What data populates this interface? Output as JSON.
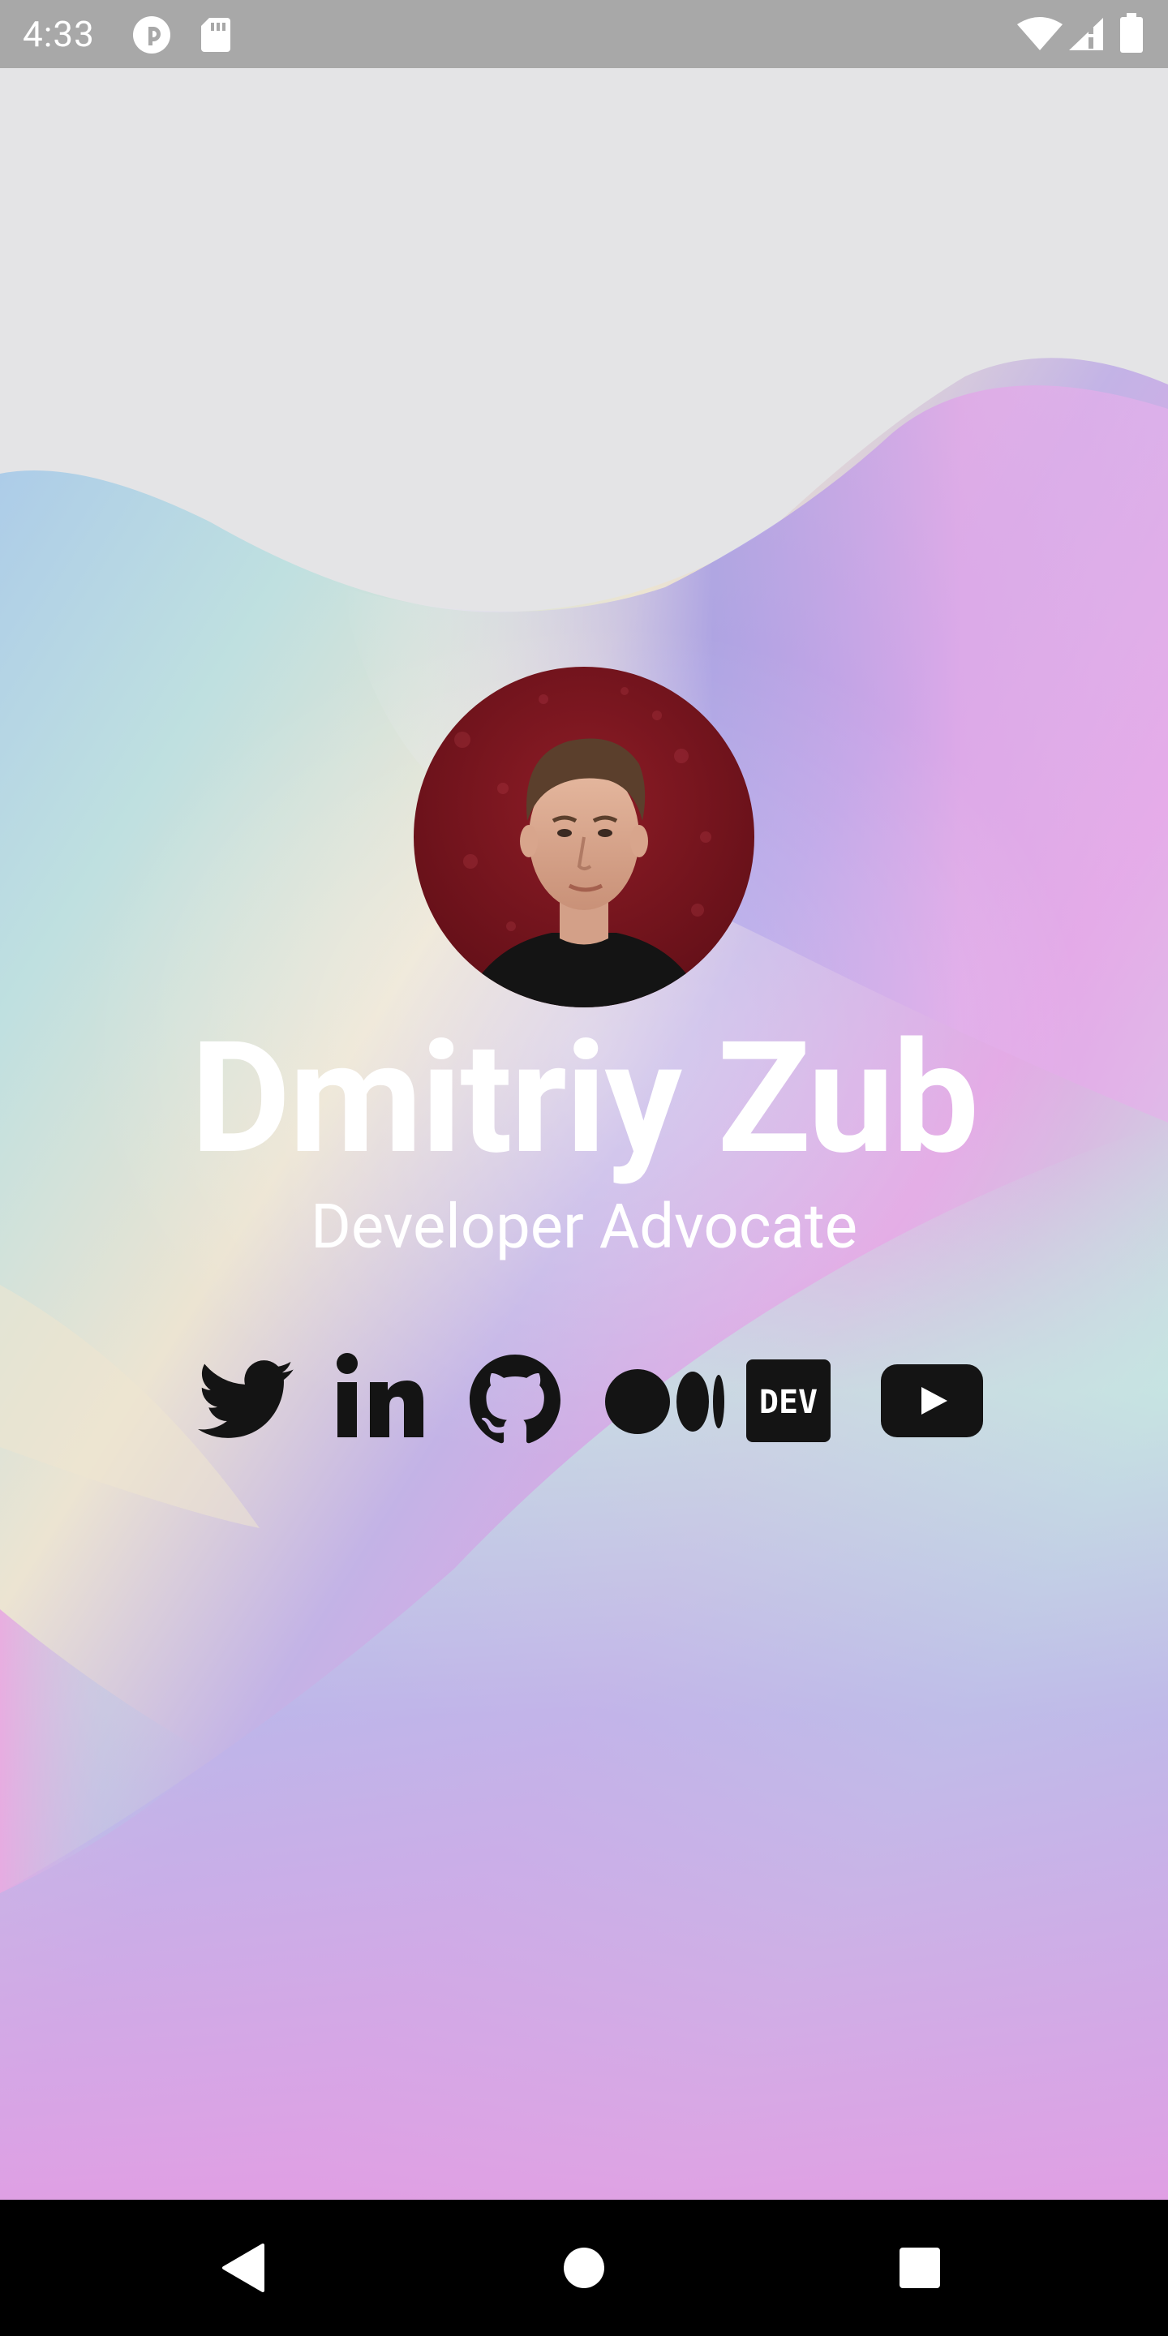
{
  "status_bar": {
    "time": "4:33",
    "left_icons": [
      "pocket-casts-icon",
      "sd-card-icon"
    ],
    "right_icons": [
      "wifi-icon",
      "cell-signal-icon",
      "battery-icon"
    ]
  },
  "profile": {
    "name": "Dmitriy Zub",
    "title": "Developer Advocate",
    "avatar_icon": "profile-photo"
  },
  "social_links": [
    {
      "icon": "twitter-icon"
    },
    {
      "icon": "linkedin-icon"
    },
    {
      "icon": "github-icon"
    },
    {
      "icon": "medium-icon"
    },
    {
      "icon": "dev-to-icon",
      "label": "DEV"
    },
    {
      "icon": "youtube-icon"
    }
  ],
  "nav_bar": {
    "buttons": [
      "back-icon",
      "home-icon",
      "recents-icon"
    ]
  },
  "colors": {
    "status_bar": "#a8a8a8",
    "nav_bar": "#000000",
    "text": "#ffffff",
    "icons": "#141414",
    "page_background": "#e4e4e6",
    "wave_violet": "#b69be8",
    "wave_pink": "#e2a6e4",
    "wave_teal": "#bfe0e0",
    "wave_cream": "#ece4d2",
    "avatar_background": "#7a1620"
  }
}
